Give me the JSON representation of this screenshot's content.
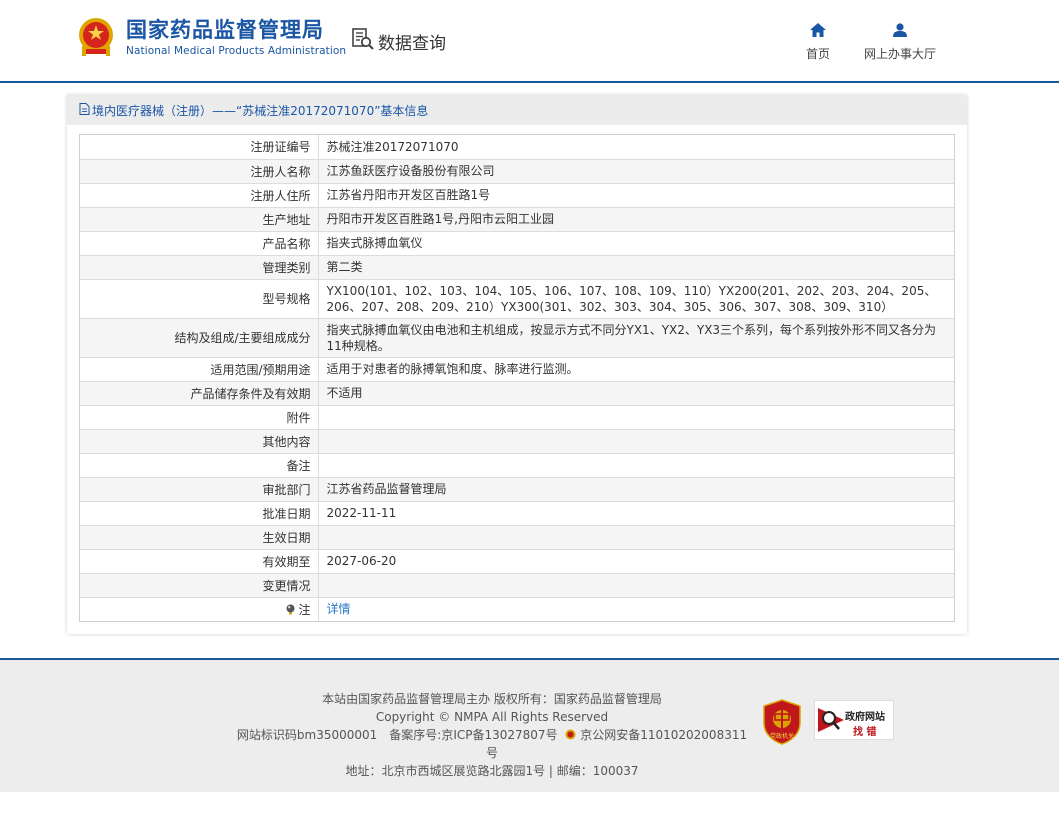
{
  "header": {
    "logo_cn": "国家药品监督管理局",
    "logo_en": "National Medical Products Administration",
    "query_label": "数据查询",
    "nav": [
      {
        "label": "首页",
        "icon": "home-icon"
      },
      {
        "label": "网上办事大厅",
        "icon": "user-icon"
      }
    ]
  },
  "panel": {
    "title": "境内医疗器械（注册）——“苏械注准20172071070”基本信息"
  },
  "rows": [
    {
      "label": "注册证编号",
      "value": "苏械注准20172071070"
    },
    {
      "label": "注册人名称",
      "value": "江苏鱼跃医疗设备股份有限公司"
    },
    {
      "label": "注册人住所",
      "value": "江苏省丹阳市开发区百胜路1号"
    },
    {
      "label": "生产地址",
      "value": "丹阳市开发区百胜路1号,丹阳市云阳工业园"
    },
    {
      "label": "产品名称",
      "value": "指夹式脉搏血氧仪"
    },
    {
      "label": "管理类别",
      "value": "第二类"
    },
    {
      "label": "型号规格",
      "value": "YX100(101、102、103、104、105、106、107、108、109、110）YX200(201、202、203、204、205、206、207、208、209、210）YX300(301、302、303、304、305、306、307、308、309、310）"
    },
    {
      "label": "结构及组成/主要组成成分",
      "value": "指夹式脉搏血氧仪由电池和主机组成，按显示方式不同分YX1、YX2、YX3三个系列，每个系列按外形不同又各分为11种规格。"
    },
    {
      "label": "适用范围/预期用途",
      "value": "适用于对患者的脉搏氧饱和度、脉率进行监测。"
    },
    {
      "label": "产品储存条件及有效期",
      "value": "不适用"
    },
    {
      "label": "附件",
      "value": ""
    },
    {
      "label": "其他内容",
      "value": ""
    },
    {
      "label": "备注",
      "value": ""
    },
    {
      "label": "审批部门",
      "value": "江苏省药品监督管理局"
    },
    {
      "label": "批准日期",
      "value": "2022-11-11"
    },
    {
      "label": "生效日期",
      "value": ""
    },
    {
      "label": "有效期至",
      "value": "2027-06-20"
    },
    {
      "label": "变更情况",
      "value": ""
    },
    {
      "label": "注",
      "value": "详情"
    }
  ],
  "footer": {
    "line1": "本站由国家药品监督管理局主办 版权所有：国家药品监督管理局",
    "line2": "Copyright © NMPA All Rights Reserved",
    "line3_a": "网站标识码bm35000001　备案序号:京ICP备13027807号",
    "line3_b": "京公网安备11010202008311号",
    "line4": "地址：北京市西城区展览路北露园1号 | 邮编：100037",
    "badge1_text": "党政机关",
    "badge2_line1": "政府网站",
    "badge2_line2": "找 错"
  },
  "colors": {
    "brand_blue": "#1a56a4",
    "link_blue": "#2a7ac8"
  }
}
